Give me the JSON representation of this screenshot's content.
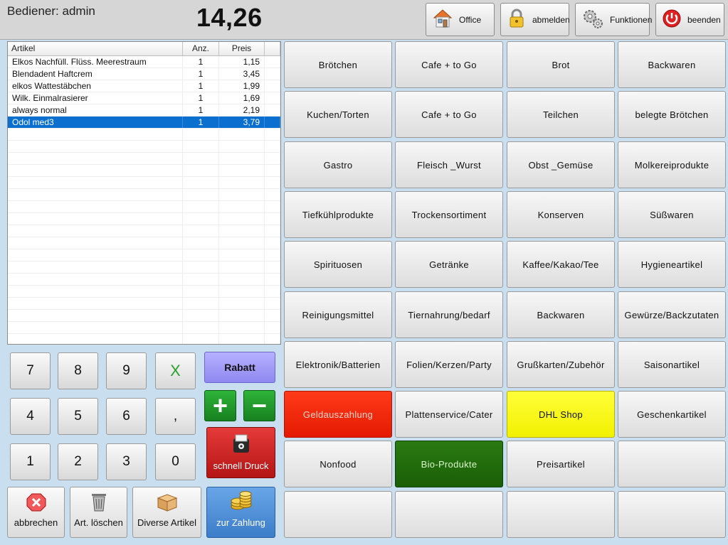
{
  "header": {
    "operator": "Bediener: admin",
    "total": "14,26",
    "buttons": [
      {
        "label": "Office",
        "icon": "house-icon"
      },
      {
        "label": "abmelden",
        "icon": "padlock-icon"
      },
      {
        "label": "Funktionen",
        "icon": "gears-icon"
      },
      {
        "label": "beenden",
        "icon": "power-icon"
      }
    ]
  },
  "receipt": {
    "columns": [
      "Artikel",
      "Anz.",
      "Preis"
    ],
    "rows": [
      {
        "artikel": "Elkos Nachfüll. Flüss. Meerestraum",
        "anz": "1",
        "preis": "1,15"
      },
      {
        "artikel": "Blendadent Haftcrem",
        "anz": "1",
        "preis": "3,45"
      },
      {
        "artikel": "elkos Wattestäbchen",
        "anz": "1",
        "preis": "1,99"
      },
      {
        "artikel": "Wilk. Einmalrasierer",
        "anz": "1",
        "preis": "1,69"
      },
      {
        "artikel": "always normal",
        "anz": "1",
        "preis": "2,19"
      },
      {
        "artikel": "Odol med3",
        "anz": "1",
        "preis": "3,79"
      }
    ],
    "selected_row": "Odol med3"
  },
  "keypad": {
    "row1": [
      "7",
      "8",
      "9",
      "X"
    ],
    "row2": [
      "4",
      "5",
      "6",
      ","
    ],
    "row3": [
      "1",
      "2",
      "3",
      "0"
    ]
  },
  "actions": {
    "rabatt": "Rabatt",
    "plus": "+",
    "minus": "−",
    "schnell_druck": "schnell Druck",
    "abbrechen": "abbrechen",
    "art_loeschen": "Art. löschen",
    "diverse_artikel": "Diverse Artikel",
    "zur_zahlung": "zur Zahlung"
  },
  "categories": {
    "row1": [
      "Brötchen",
      "Cafe + to Go",
      "Brot",
      "Backwaren"
    ],
    "row2": [
      "Kuchen/Torten",
      "Cafe + to Go",
      "Teilchen",
      "belegte Brötchen"
    ],
    "row3": [
      "Gastro",
      "Fleisch _Wurst",
      "Obst _Gemüse",
      "Molkereiprodukte"
    ],
    "row4": [
      "Tiefkühlprodukte",
      "Trockensortiment",
      "Konserven",
      "Süßwaren"
    ],
    "row5": [
      "Spirituosen",
      "Getränke",
      "Kaffee/Kakao/Tee",
      "Hygieneartikel"
    ],
    "row6": [
      "Reinigungsmittel",
      "Tiernahrung/bedarf",
      "Backwaren",
      "Gewürze/Backzutaten"
    ],
    "row7": [
      "Elektronik/Batterien",
      "Folien/Kerzen/Party",
      "Grußkarten/Zubehör",
      "Saisonartikel"
    ],
    "row8": [
      "Geldauszahlung",
      "Plattenservice/Cater",
      "DHL Shop",
      "Geschenkartikel"
    ],
    "row9": [
      "Nonfood",
      "Bio-Produkte",
      "Preisartikel",
      ""
    ],
    "row10": [
      "",
      "",
      "",
      ""
    ]
  },
  "colors": {
    "geldauszahlung": "#ff2200",
    "dhl_shop": "#ffff00",
    "bio_produkte": "#1f6f0a",
    "selection": "#0a6fce",
    "rabatt": "#9f99ff",
    "zur_zahlung": "#4a8ad6",
    "schnell_druck": "#cc2020"
  }
}
